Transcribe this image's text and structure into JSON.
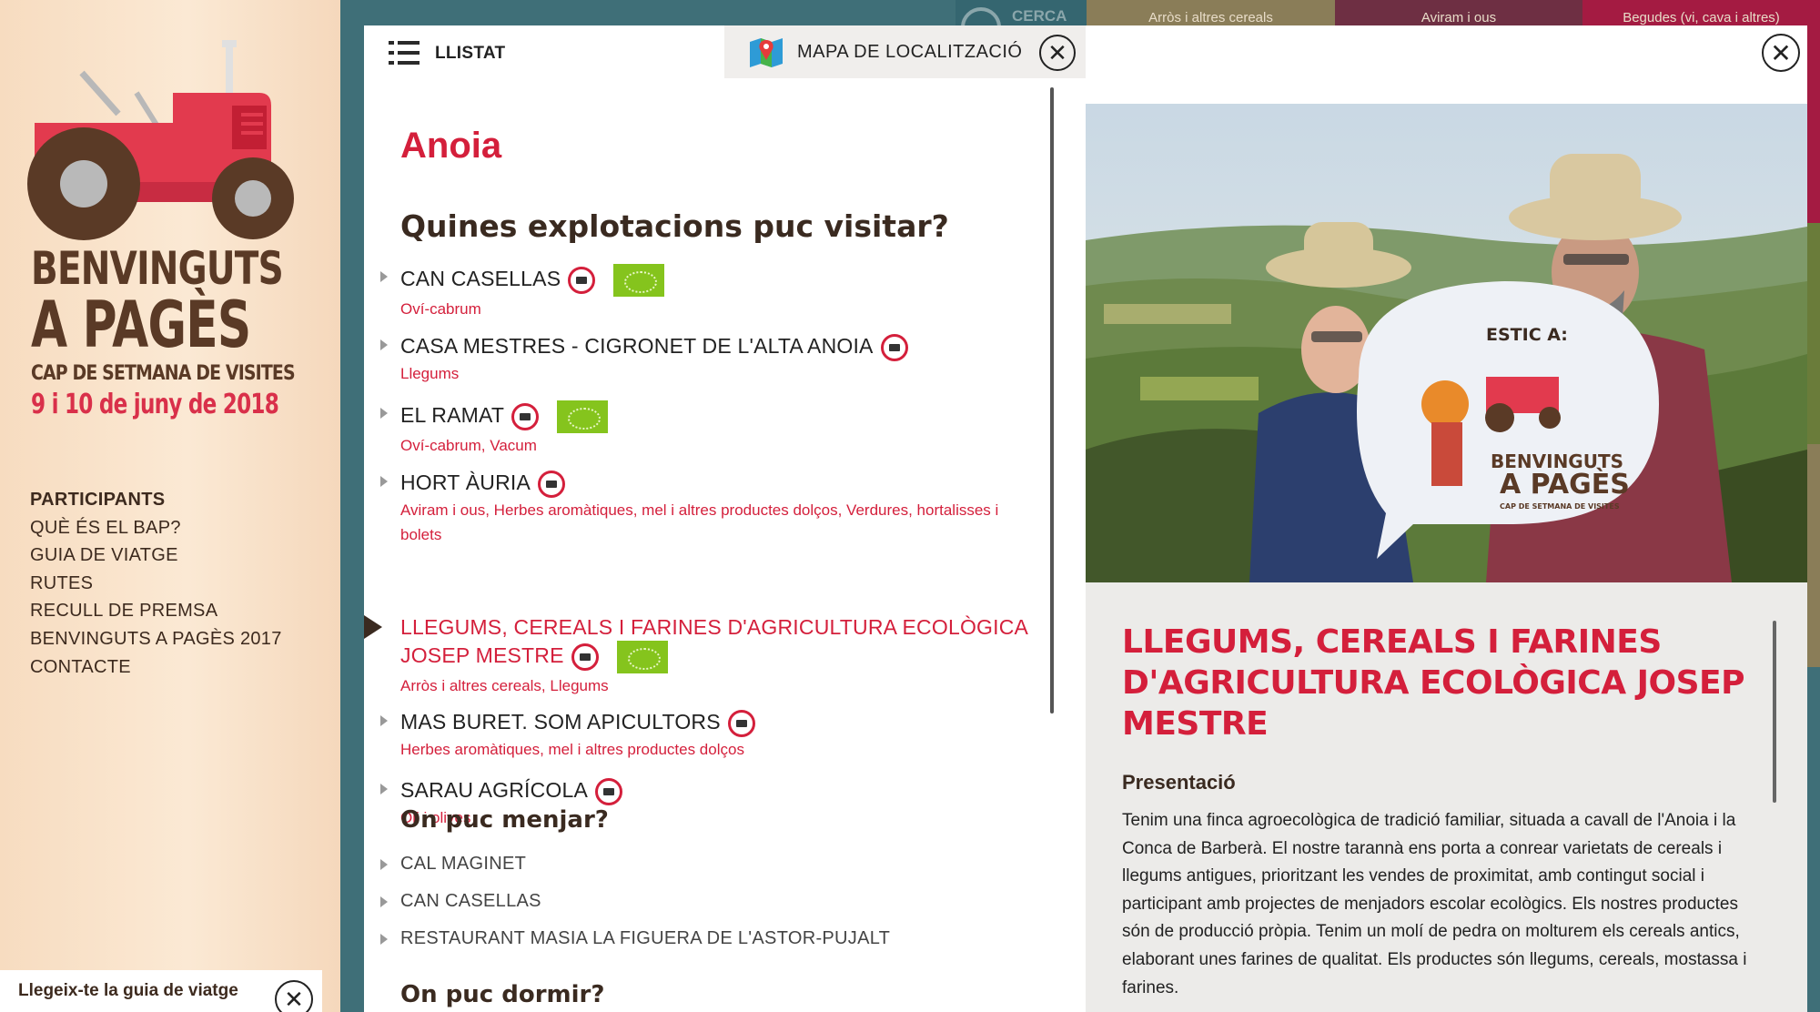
{
  "colors": {
    "accent_red": "#d41f3b",
    "dark_brown": "#3a2a20",
    "teal_bg": "#3f6f78",
    "eco_green": "#85c41d"
  },
  "logo": {
    "line1": "BENVINGUTS",
    "line2": "A PAGÈS",
    "line3": "CAP DE SETMANA DE VISITES",
    "line4": "9 i 10 de juny de 2018"
  },
  "sidebar": {
    "nav": [
      {
        "label": "PARTICIPANTS",
        "active": true
      },
      {
        "label": "QUÈ ÉS EL BAP?"
      },
      {
        "label": "GUIA DE VIATGE"
      },
      {
        "label": "RUTES"
      },
      {
        "label": "RECULL DE PREMSA"
      },
      {
        "label": "BENVINGUTS A PAGÈS 2017"
      },
      {
        "label": "CONTACTE"
      }
    ],
    "guide_label": "Llegeix-te la guia de viatge",
    "guide_close_icon": "close-icon"
  },
  "background_strip": {
    "search": "CERCA",
    "categories": [
      "Arròs i altres cereals",
      "Aviram i ous",
      "Begudes (vi, cava i altres)"
    ]
  },
  "list": {
    "header_label": "LLISTAT",
    "map_tab_label": "MAPA DE LOCALITZACIÓ",
    "region": "Anoia",
    "section_visit": "Quines explotacions puc visitar?",
    "farms": [
      {
        "name": "CAN CASELLAS",
        "categories": "Oví-cabrum",
        "eco": true
      },
      {
        "name": "CASA MESTRES - CIGRONET DE L'ALTA ANOIA",
        "categories": "Llegums",
        "eco": false
      },
      {
        "name": "EL RAMAT",
        "categories": "Oví-cabrum, Vacum",
        "eco": true
      },
      {
        "name": "HORT ÀURIA",
        "categories": "Aviram i ous, Herbes aromàtiques, mel i altres productes dolços, Verdures, hortalisses i bolets",
        "eco": false
      },
      {
        "name_line1": "LLEGUMS, CEREALS I FARINES D'AGRICULTURA ECOLÒGICA",
        "name_line2": "JOSEP MESTRE",
        "categories": "Arròs i altres cereals, Llegums",
        "eco": true,
        "active": true
      },
      {
        "name": "MAS BURET. SOM APICULTORS",
        "categories": "Herbes aromàtiques, mel i altres productes dolços",
        "eco": false
      },
      {
        "name": "SARAU AGRÍCOLA",
        "categories": "Oli i olives",
        "eco": false
      }
    ],
    "section_eat": "On puc menjar?",
    "eat": [
      "CAL MAGINET",
      "CAN CASELLAS",
      "RESTAURANT MASIA LA FIGUERA DE L'ASTOR-PUJALT"
    ],
    "section_sleep": "On puc dormir?"
  },
  "detail": {
    "photo_sign_text": "ESTIC A:",
    "photo_sign_logo1": "BENVINGUTS",
    "photo_sign_logo2": "A PAGÈS",
    "photo_sign_logo3": "CAP DE SETMANA DE VISITES",
    "title": "LLEGUMS, CEREALS I FARINES D'AGRICULTURA ECOLÒGICA JOSEP MESTRE",
    "presentation_heading": "Presentació",
    "presentation_body": "Tenim una finca agroecològica de tradició familiar, situada a cavall de l'Anoia i la Conca de Barberà. El nostre tarannà ens porta a conrear varietats de cereals i llegums antigues, prioritzant les vendes de proximitat, amb contingut social i participant amb projectes de menjadors escolar ecològics. Els nostres productes són de producció pròpia. Tenim un molí de pedra on molturem els cereals antics, elaborant unes farines de qualitat. Els productes són llegums, cereals, mostassa i farines."
  }
}
